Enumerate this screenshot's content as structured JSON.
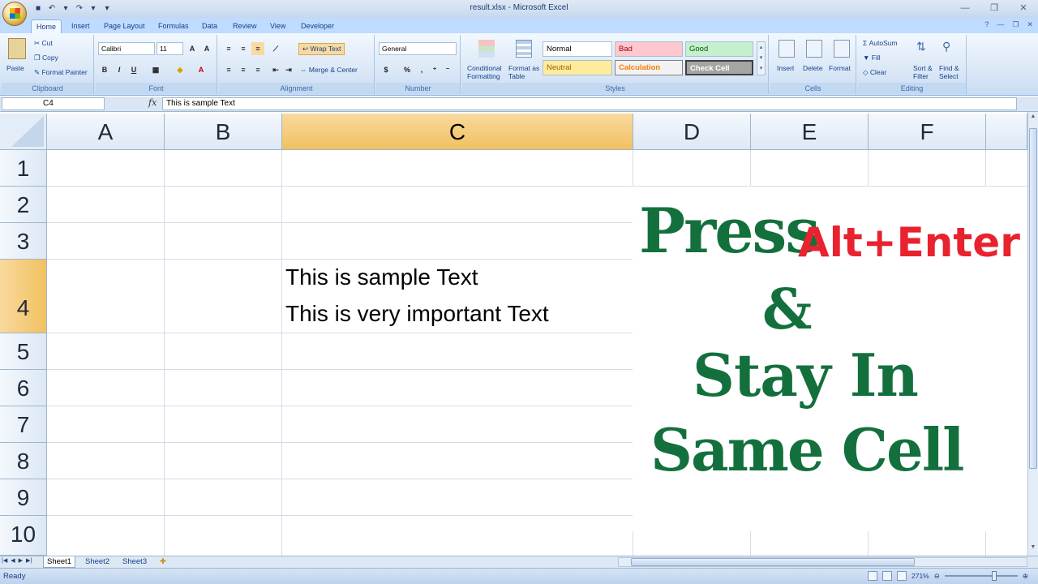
{
  "window": {
    "title": "result.xlsx - Microsoft Excel"
  },
  "ribbon_tabs": [
    "Home",
    "Insert",
    "Page Layout",
    "Formulas",
    "Data",
    "Review",
    "View",
    "Developer"
  ],
  "clipboard": {
    "paste": "Paste",
    "cut": "Cut",
    "copy": "Copy",
    "format_painter": "Format Painter",
    "label": "Clipboard"
  },
  "font": {
    "name": "Calibri",
    "size": "11",
    "label": "Font",
    "bold": "B",
    "italic": "I",
    "underline": "U"
  },
  "alignment": {
    "wrap_text": "Wrap Text",
    "merge_center": "Merge & Center",
    "label": "Alignment"
  },
  "number": {
    "format": "General",
    "currency": "$",
    "percent": "%",
    "comma": ",",
    "label": "Number"
  },
  "styles": {
    "conditional": "Conditional",
    "formatting": "Formatting",
    "format_as": "Format as",
    "table": "Table",
    "normal": "Normal",
    "bad": "Bad",
    "good": "Good",
    "neutral": "Neutral",
    "calculation": "Calculation",
    "check_cell": "Check Cell",
    "label": "Styles"
  },
  "cells": {
    "insert": "Insert",
    "delete": "Delete",
    "format": "Format",
    "label": "Cells"
  },
  "editing": {
    "autosum": "AutoSum",
    "fill": "Fill",
    "clear": "Clear",
    "sort": "Sort &",
    "filter": "Filter",
    "find": "Find &",
    "select": "Select",
    "label": "Editing"
  },
  "formula_bar": {
    "name_box": "C4",
    "fx": "fx",
    "content": "This is sample Text"
  },
  "columns": [
    "A",
    "B",
    "C",
    "D",
    "E",
    "F"
  ],
  "rows": [
    "1",
    "2",
    "3",
    "4",
    "5",
    "6",
    "7",
    "8",
    "9",
    "10"
  ],
  "cell_c4": {
    "line1": "This is sample Text",
    "line2": "This is very important Text"
  },
  "overlay": {
    "press": "Press",
    "alt_enter": "Alt+Enter",
    "amp": "&",
    "stay_in": "Stay In",
    "same_cell": "Same Cell"
  },
  "sheets": [
    "Sheet1",
    "Sheet2",
    "Sheet3"
  ],
  "status": {
    "ready": "Ready",
    "zoom": "271%"
  },
  "colors": {
    "overlay_green": "#13703d",
    "overlay_red": "#e8222e",
    "ribbon_blue": "#15428b"
  }
}
